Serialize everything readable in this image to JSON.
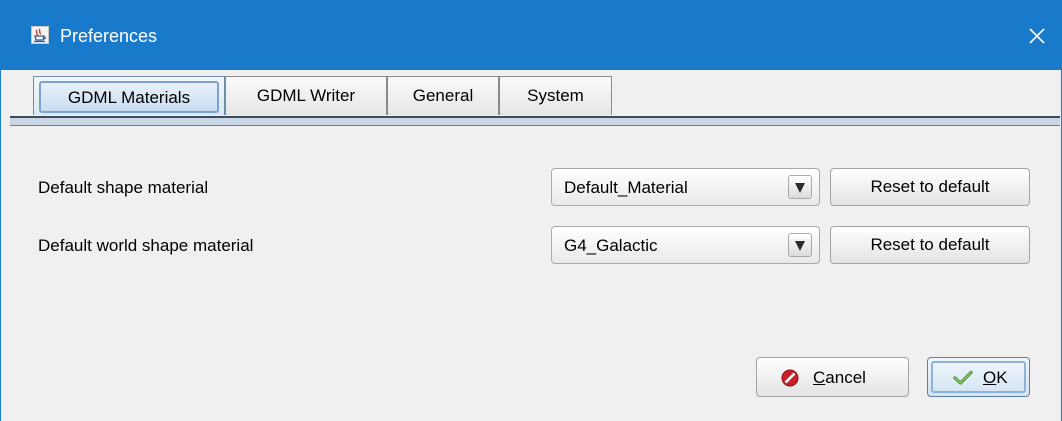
{
  "window": {
    "title": "Preferences",
    "icon": "java-cup-icon",
    "close_icon": "close-icon",
    "accent_color": "#1979ca"
  },
  "tabs": [
    {
      "label": "GDML Materials",
      "active": true
    },
    {
      "label": "GDML Writer",
      "active": false
    },
    {
      "label": "General",
      "active": false
    },
    {
      "label": "System",
      "active": false
    }
  ],
  "settings": [
    {
      "label": "Default shape material",
      "selected_value": "Default_Material",
      "reset_label": "Reset to default"
    },
    {
      "label": "Default world shape material",
      "selected_value": "G4_Galactic",
      "reset_label": "Reset to default"
    }
  ],
  "footer": {
    "cancel": {
      "mnemonic": "C",
      "rest": "ancel",
      "icon": "cancel-icon"
    },
    "ok": {
      "mnemonic": "O",
      "rest": "K",
      "icon": "checkmark-icon"
    }
  }
}
